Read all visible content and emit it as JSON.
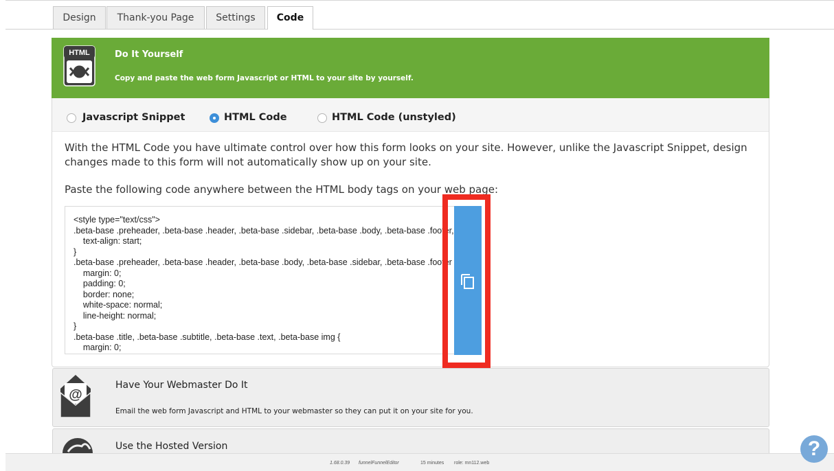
{
  "tabs": [
    {
      "label": "Design"
    },
    {
      "label": "Thank-you Page"
    },
    {
      "label": "Settings"
    },
    {
      "label": "Code"
    }
  ],
  "diy": {
    "icon_label": "HTML",
    "title": "Do It Yourself",
    "description": "Copy and paste the web form Javascript or HTML to your site by yourself."
  },
  "options": [
    {
      "label": "Javascript Snippet",
      "checked": false
    },
    {
      "label": "HTML Code",
      "checked": true
    },
    {
      "label": "HTML Code (unstyled)",
      "checked": false
    }
  ],
  "info": {
    "line1": "With the HTML Code you have ultimate control over how this form looks on your site. However, unlike the Javascript Snippet, design",
    "line2": "changes made to this form will not automatically show up on your site.",
    "paste_instruction": "Paste the following code anywhere between the HTML body tags on your web page:"
  },
  "code": {
    "text": "<style type=\"text/css\">\n.beta-base .preheader, .beta-base .header, .beta-base .sidebar, .beta-base .body, .beta-base .footer, #\n    text-align: start;\n}\n.beta-base .preheader, .beta-base .header, .beta-base .body, .beta-base .sidebar, .beta-base .footer {\n    margin: 0;\n    padding: 0;\n    border: none;\n    white-space: normal;\n    line-height: normal;\n}\n.beta-base .title, .beta-base .subtitle, .beta-base .text, .beta-base img {\n    margin: 0;"
  },
  "copy_button": {
    "icon": "copy-icon",
    "color": "#4d9ee0"
  },
  "webmaster": {
    "title": "Have Your Webmaster Do It",
    "description": "Email the web form Javascript and HTML to your webmaster so they can put it on your site for you."
  },
  "hosted": {
    "title": "Use the Hosted Version"
  },
  "footer": {
    "version": "1.68.0.39",
    "editor": "funnelFunnelEditor",
    "time": "15 minutes",
    "role": "role: mn112.web"
  },
  "help": {
    "symbol": "?"
  },
  "colors": {
    "green": "#6aab38",
    "blue": "#4d9ee0",
    "red": "#ef2b21"
  }
}
